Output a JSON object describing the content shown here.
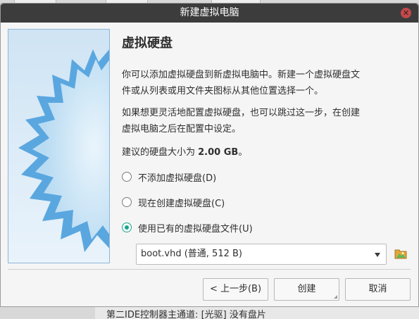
{
  "window": {
    "title": "新建虚拟电脑"
  },
  "page": {
    "title": "虚拟硬盘",
    "description": "你可以添加虚拟硬盘到新虚拟电脑中。新建一个虚拟硬盘文件或从列表或用文件夹图标从其他位置选择一个。",
    "description_line1": "你可以添加虚拟硬盘到新虚拟电脑中。新建一个虚拟硬盘文",
    "description_line2": "件或从列表或用文件夹图标从其他位置选择一个。",
    "hint_line1": "如果想更灵活地配置虚拟硬盘，也可以跳过这一步，在创建",
    "hint_line2": "虚拟电脑之后在配置中设定。",
    "suggest_prefix": "建议的硬盘大小为 ",
    "suggest_value": "2.00 GB",
    "suggest_suffix": "。"
  },
  "options": [
    {
      "label": "不添加虚拟硬盘(D)",
      "checked": false
    },
    {
      "label": "现在创建虚拟硬盘(C)",
      "checked": false
    },
    {
      "label": "使用已有的虚拟硬盘文件(U)",
      "checked": true
    }
  ],
  "disk_select": {
    "value": "boot.vhd (普通, 512 B)"
  },
  "buttons": {
    "back": "< 上一步(B)",
    "create": "创建",
    "cancel": "取消"
  },
  "background": {
    "status_text": "第二IDE控制器主通道:  [光驱] 没有盘片"
  },
  "colors": {
    "titlebar": "#3c3c3c",
    "radio_accent": "#17a589",
    "close_button": "#c2494c"
  },
  "icons": {
    "close": "close-icon",
    "folder": "folder-icon",
    "dropdown": "chevron-down-icon"
  }
}
